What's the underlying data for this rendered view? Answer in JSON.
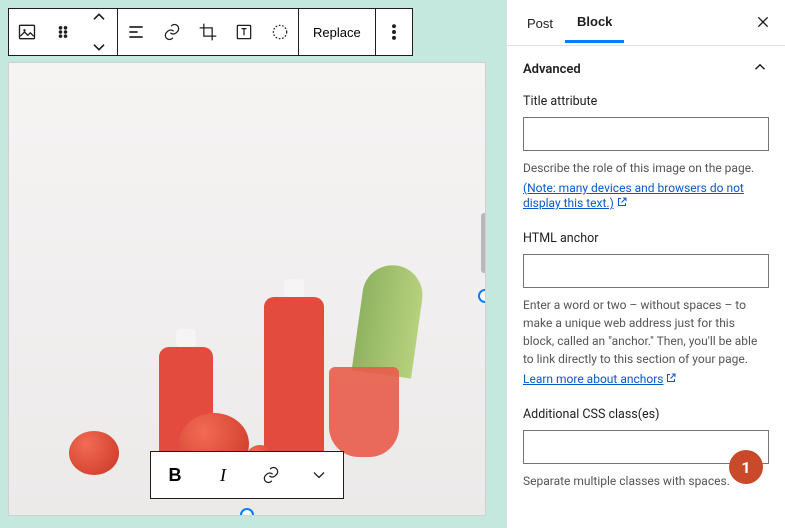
{
  "toolbar": {
    "replace_label": "Replace"
  },
  "inline_toolbar": {
    "bold": "B",
    "italic": "I"
  },
  "sidebar": {
    "tabs": {
      "post": "Post",
      "block": "Block"
    },
    "section": "Advanced",
    "title_attribute": {
      "label": "Title attribute",
      "value": "",
      "desc": "Describe the role of this image on the page.",
      "note": "(Note: many devices and browsers do not display this text.)"
    },
    "html_anchor": {
      "label": "HTML anchor",
      "value": "",
      "desc": "Enter a word or two – without spaces – to make a unique web address just for this block, called an \"anchor.\" Then, you'll be able to link directly to this section of your page.",
      "link": "Learn more about anchors"
    },
    "css_class": {
      "label": "Additional CSS class(es)",
      "value": "",
      "desc": "Separate multiple classes with spaces."
    }
  },
  "annotation": "1"
}
